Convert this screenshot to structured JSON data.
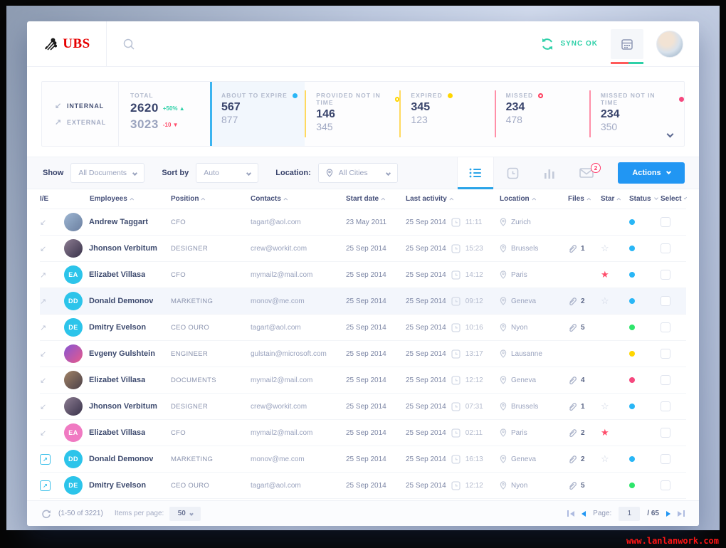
{
  "page": {
    "watermark": "www.lanlanwork.com"
  },
  "colors": {
    "accent_blue": "#2196f3",
    "cyan_avatar": "#2cc4ea",
    "teal": "#2ed0a8",
    "status_blue": "#29b6f6",
    "status_green": "#2ee56b",
    "status_yellow": "#ffd600",
    "status_red": "#f5487e",
    "ubs_red": "#e60000"
  },
  "header": {
    "logo_text": "UBS",
    "sync_label": "SYNC OK",
    "icons": {
      "search": "search-icon",
      "sync": "sync-icon",
      "calendar": "calendar-icon",
      "avatar": "user-avatar"
    }
  },
  "stats": {
    "internal_label": "INTERNAL",
    "external_label": "EXTERNAL",
    "total": {
      "label": "TOTAL",
      "internal_value": "2620",
      "internal_delta": "+50%",
      "internal_trend": "up",
      "external_value": "3023",
      "external_delta": "-10",
      "external_trend": "down"
    },
    "cards": [
      {
        "label": "ABOUT TO EXPIRE",
        "value_top": "567",
        "value_bottom": "877",
        "color": "#3cb4f0",
        "dot_color": "#29b6f6",
        "dot": "filled",
        "active": true
      },
      {
        "label": "PROVIDED NOT IN TIME",
        "value_top": "146",
        "value_bottom": "345",
        "color": "#ffd95e",
        "dot_color": "#ffd600",
        "dot": "outline",
        "active": false
      },
      {
        "label": "EXPIRED",
        "value_top": "345",
        "value_bottom": "123",
        "color": "#ffd95e",
        "dot_color": "#ffd600",
        "dot": "filled",
        "active": false
      },
      {
        "label": "MISSED",
        "value_top": "234",
        "value_bottom": "478",
        "color": "#ff8fa8",
        "dot_color": "#ff3b5c",
        "dot": "outline",
        "active": false
      },
      {
        "label": "MISSED NOT IN TIME",
        "value_top": "234",
        "value_bottom": "350",
        "color": "#ff8fa8",
        "dot_color": "#f5487e",
        "dot": "filled",
        "active": false
      }
    ]
  },
  "toolbar": {
    "show_label": "Show",
    "show_value": "All Documents",
    "sort_label": "Sort by",
    "sort_value": "Auto",
    "location_label": "Location:",
    "location_value": "All Cities",
    "view_icons": [
      "list-view-icon",
      "time-view-icon",
      "chart-view-icon",
      "mail-view-icon"
    ],
    "mail_badge": "2",
    "actions_label": "Actions"
  },
  "table": {
    "columns": [
      {
        "label": "I/E",
        "sort": ""
      },
      {
        "label": "Employees",
        "sort": "asc"
      },
      {
        "label": "Position",
        "sort": "asc"
      },
      {
        "label": "Contacts",
        "sort": "asc"
      },
      {
        "label": "Start date",
        "sort": "asc"
      },
      {
        "label": "Last activity",
        "sort": "asc"
      },
      {
        "label": "Location",
        "sort": "asc"
      },
      {
        "label": "Files",
        "sort": "asc"
      },
      {
        "label": "Star",
        "sort": "asc"
      },
      {
        "label": "Status",
        "sort": "desc"
      },
      {
        "label": "Select",
        "sort": "desc"
      }
    ],
    "rows": [
      {
        "ie": "in",
        "avatar": {
          "type": "photo",
          "colors": [
            "#9db6d2",
            "#6b7fa0"
          ]
        },
        "name": "Andrew Taggart",
        "position": "CFO",
        "contact": "tagart@aol.com",
        "start_date": "23 May 2011",
        "activity_date": "25 Sep 2014",
        "activity_time": "11:11",
        "location": "Zurich",
        "files": "",
        "star": "",
        "status": "#29b6f6",
        "highlight": false
      },
      {
        "ie": "in",
        "avatar": {
          "type": "photo",
          "colors": [
            "#8d7d92",
            "#39324a"
          ]
        },
        "name": "Jhonson Verbitum",
        "position": "DESIGNER",
        "contact": "crew@workit.com",
        "start_date": "25 Sep 2014",
        "activity_date": "25 Sep 2014",
        "activity_time": "15:23",
        "location": "Brussels",
        "files": "1",
        "star": "empty",
        "status": "#29b6f6",
        "highlight": false
      },
      {
        "ie": "out",
        "avatar": {
          "type": "initials",
          "text": "EA",
          "color": "#2cc4ea"
        },
        "name": "Elizabet Villasa",
        "position": "CFO",
        "contact": "mymail2@mail.com",
        "start_date": "25 Sep 2014",
        "activity_date": "25 Sep 2014",
        "activity_time": "14:12",
        "location": "Paris",
        "files": "",
        "star": "filled",
        "status": "#29b6f6",
        "highlight": false
      },
      {
        "ie": "out",
        "avatar": {
          "type": "initials",
          "text": "DD",
          "color": "#2cc4ea"
        },
        "name": "Donald Demonov",
        "position": "MARKETING",
        "contact": "monov@me.com",
        "start_date": "25 Sep 2014",
        "activity_date": "25 Sep 2014",
        "activity_time": "09:12",
        "location": "Geneva",
        "files": "2",
        "star": "empty",
        "status": "#29b6f6",
        "highlight": true
      },
      {
        "ie": "out",
        "avatar": {
          "type": "initials",
          "text": "DE",
          "color": "#2cc4ea"
        },
        "name": "Dmitry Evelson",
        "position": "CEO OURO",
        "contact": "tagart@aol.com",
        "start_date": "25 Sep 2014",
        "activity_date": "25 Sep 2014",
        "activity_time": "10:16",
        "location": "Nyon",
        "files": "5",
        "star": "",
        "status": "#2ee56b",
        "highlight": false
      },
      {
        "ie": "in",
        "avatar": {
          "type": "photo",
          "colors": [
            "#8655d4",
            "#e85a8a"
          ]
        },
        "name": "Evgeny Gulshtein",
        "position": "ENGINEER",
        "contact": "gulstain@microsoft.com",
        "start_date": "25 Sep 2014",
        "activity_date": "25 Sep 2014",
        "activity_time": "13:17",
        "location": "Lausanne",
        "files": "",
        "star": "",
        "status": "#ffd600",
        "highlight": false
      },
      {
        "ie": "in",
        "avatar": {
          "type": "photo",
          "colors": [
            "#a28366",
            "#4a4049"
          ]
        },
        "name": "Elizabet Villasa",
        "position": "DOCUMENTS",
        "contact": "mymail2@mail.com",
        "start_date": "25 Sep 2014",
        "activity_date": "25 Sep 2014",
        "activity_time": "12:12",
        "location": "Geneva",
        "files": "4",
        "star": "",
        "status": "#f5487e",
        "highlight": false
      },
      {
        "ie": "in",
        "avatar": {
          "type": "photo",
          "colors": [
            "#8d7d92",
            "#39324a"
          ]
        },
        "name": "Jhonson Verbitum",
        "position": "DESIGNER",
        "contact": "crew@workit.com",
        "start_date": "25 Sep 2014",
        "activity_date": "25 Sep 2014",
        "activity_time": "07:31",
        "location": "Brussels",
        "files": "1",
        "star": "empty",
        "status": "#29b6f6",
        "highlight": false
      },
      {
        "ie": "in",
        "avatar": {
          "type": "initials",
          "text": "EA",
          "color": "#f07ac2"
        },
        "name": "Elizabet Villasa",
        "position": "CFO",
        "contact": "mymail2@mail.com",
        "start_date": "25 Sep 2014",
        "activity_date": "25 Sep 2014",
        "activity_time": "02:11",
        "location": "Paris",
        "files": "2",
        "star": "filled",
        "status": "",
        "highlight": false
      },
      {
        "ie": "export",
        "avatar": {
          "type": "initials",
          "text": "DD",
          "color": "#2cc4ea"
        },
        "name": "Donald Demonov",
        "position": "MARKETING",
        "contact": "monov@me.com",
        "start_date": "25 Sep 2014",
        "activity_date": "25 Sep 2014",
        "activity_time": "16:13",
        "location": "Geneva",
        "files": "2",
        "star": "empty",
        "status": "#29b6f6",
        "highlight": false
      },
      {
        "ie": "export",
        "avatar": {
          "type": "initials",
          "text": "DE",
          "color": "#2cc4ea"
        },
        "name": "Dmitry Evelson",
        "position": "CEO OURO",
        "contact": "tagart@aol.com",
        "start_date": "25 Sep 2014",
        "activity_date": "25 Sep 2014",
        "activity_time": "12:12",
        "location": "Nyon",
        "files": "5",
        "star": "",
        "status": "#2ee56b",
        "highlight": false
      }
    ]
  },
  "footer": {
    "range": "(1-50 of 3221)",
    "items_label": "Items per page:",
    "items_value": "50",
    "page_label": "Page:",
    "page_value": "1",
    "page_total": "/ 65"
  }
}
